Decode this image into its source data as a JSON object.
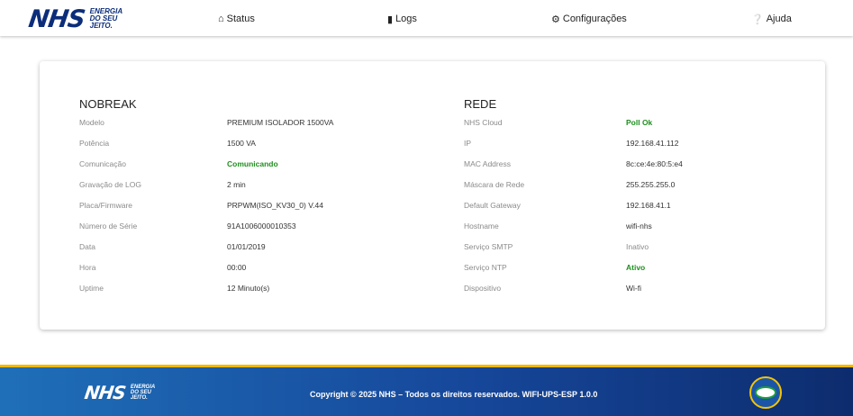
{
  "brand": {
    "logo_text": "NHS",
    "tagline": [
      "ENERGIA",
      "DO SEU",
      "JEITO."
    ]
  },
  "nav": [
    {
      "label": "Status",
      "icon": "home-icon"
    },
    {
      "label": "Logs",
      "icon": "file-icon"
    },
    {
      "label": "Configurações",
      "icon": "gears-icon"
    },
    {
      "label": "Ajuda",
      "icon": "question-icon"
    }
  ],
  "nobreak": {
    "title": "NOBREAK",
    "rows": [
      {
        "label": "Modelo",
        "value": "PREMIUM ISOLADOR 1500VA"
      },
      {
        "label": "Potência",
        "value": "1500 VA"
      },
      {
        "label": "Comunicação",
        "value": "Comunicando"
      },
      {
        "label": "Gravação de LOG",
        "value": "2 min"
      },
      {
        "label": "Placa/Firmware",
        "value": "PRPWM(ISO_KV30_0) V.44"
      },
      {
        "label": "Número de Série",
        "value": "91A1006000010353"
      },
      {
        "label": "Data",
        "value": "01/01/2019"
      },
      {
        "label": "Hora",
        "value": "00:00"
      },
      {
        "label": "Uptime",
        "value": "12 Minuto(s)"
      }
    ]
  },
  "rede": {
    "title": "REDE",
    "rows": [
      {
        "label": "NHS Cloud",
        "value": "Poll Ok"
      },
      {
        "label": "IP",
        "value": "192.168.41.112"
      },
      {
        "label": "MAC Address",
        "value": "8c:ce:4e:80:5:e4"
      },
      {
        "label": "Máscara de Rede",
        "value": "255.255.255.0"
      },
      {
        "label": "Default Gateway",
        "value": "192.168.41.1"
      },
      {
        "label": "Hostname",
        "value": "wifi-nhs"
      },
      {
        "label": "Serviço SMTP",
        "value": "Inativo"
      },
      {
        "label": "Serviço NTP",
        "value": "Ativo"
      },
      {
        "label": "Dispositivo",
        "value": "Wi-fi"
      }
    ]
  },
  "footer": {
    "copyright": "Copyright © 2025 NHS – Todos os direitos reservados. WIFI-UPS-ESP 1.0.0"
  },
  "colors": {
    "brand_blue": "#0b2d7a",
    "status_ok": "#1e8f1e",
    "footer_accent": "#f5b800"
  }
}
